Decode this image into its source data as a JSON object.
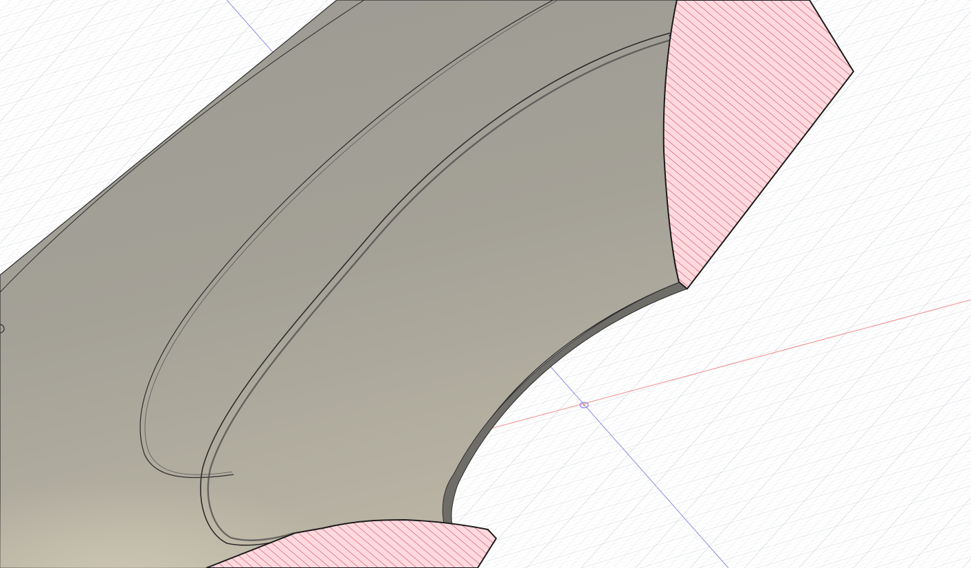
{
  "viewport": {
    "kind": "cad-3d-viewport",
    "view": "section-analysis",
    "background_color": "#ffffff",
    "grid": {
      "visible": true,
      "line_color": "#d4d8de"
    },
    "axes": {
      "x_color": "#f08a8a",
      "z_color": "#8a8ae8"
    },
    "model": {
      "body_color": "#9c9a92",
      "body_highlight_color": "#b8b3a3",
      "edge_color": "#2a2a2a",
      "section_fill_color": "#ffd9de",
      "section_hatch_color": "#c0304a"
    },
    "origin_marker_icon": "origin-point-icon"
  }
}
